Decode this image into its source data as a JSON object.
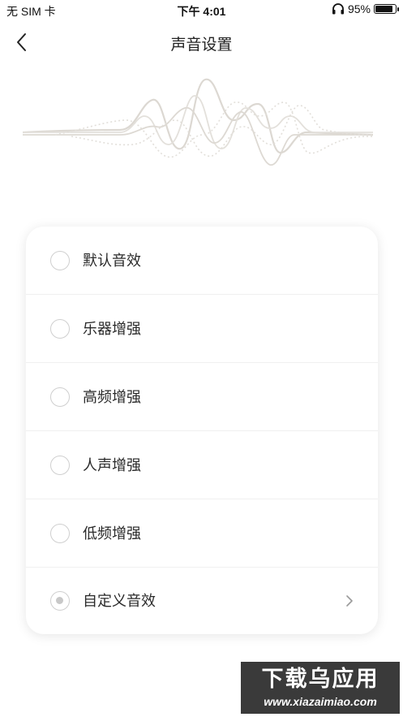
{
  "status_bar": {
    "carrier": "无 SIM 卡",
    "time": "下午 4:01",
    "battery_percent": "95%",
    "battery_level": 0.95,
    "headphones_icon": "headphones-icon"
  },
  "nav": {
    "title": "声音设置",
    "back_icon": "chevron-left-icon"
  },
  "options": [
    {
      "label": "默认音效",
      "selected": false
    },
    {
      "label": "乐器增强",
      "selected": false
    },
    {
      "label": "高频增强",
      "selected": false
    },
    {
      "label": "人声增强",
      "selected": false
    },
    {
      "label": "低频增强",
      "selected": false
    },
    {
      "label": "自定义音效",
      "selected": true,
      "has_chevron": true
    }
  ],
  "watermark": {
    "title": "下载乌应用",
    "url": "www.xiazaimiao.com"
  },
  "colors": {
    "wave": "#d8d4cf",
    "radio_border": "#cfcfcf",
    "radio_dot": "#c8c8c8",
    "text": "#2a2a2a"
  }
}
